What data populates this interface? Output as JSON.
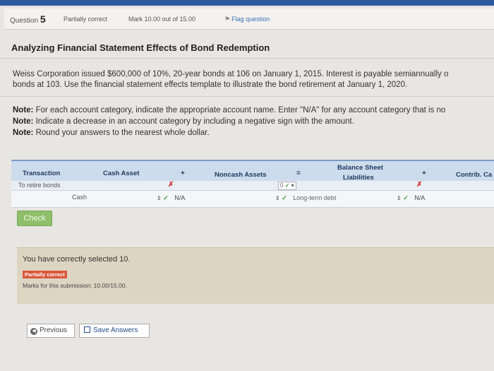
{
  "header": {
    "question_label": "Question",
    "question_number": "5",
    "status": "Partially correct",
    "mark": "Mark 10.00 out of 15.00",
    "flag": "Flag question"
  },
  "title": "Analyzing Financial Statement Effects of Bond Redemption",
  "problem": {
    "line1": "Weiss Corporation issued $600,000 of 10%, 20-year bonds at 106 on January 1, 2015. Interest is payable semiannually o",
    "line2": "bonds at 103. Use the financial statement effects template to illustrate the bond retirement at January 1, 2020."
  },
  "notes": [
    {
      "label": "Note:",
      "text": " For each account category, indicate the appropriate account name. Enter \"N/A\" for any account category that is no"
    },
    {
      "label": "Note:",
      "text": " Indicate a decrease in an account category by including a negative sign with the amount."
    },
    {
      "label": "Note:",
      "text": " Round your answers to the nearest whole dollar."
    }
  ],
  "table": {
    "balance_sheet_label": "Balance Sheet",
    "headers": {
      "transaction": "Transaction",
      "cash_asset": "Cash Asset",
      "plus1": "+",
      "noncash_assets": "Noncash Assets",
      "equals": "=",
      "liabilities": "Liabilities",
      "plus2": "+",
      "contrib": "Contrib. Ca"
    },
    "row_label": "To retire bonds",
    "row": {
      "cash_account": "Cash",
      "noncash_value": "N/A",
      "liability_dropdown": "0",
      "liability_account": "Long-term debt",
      "contrib_value": "N/A"
    }
  },
  "check_button": "Check",
  "feedback": {
    "message": "You have correctly selected 10.",
    "badge": "Partially correct",
    "marks": "Marks for this submission: 10.00/15.00."
  },
  "nav": {
    "previous": "Previous",
    "save": "Save Answers"
  },
  "colors": {
    "top_bar": "#2c5aa0",
    "check_button": "#8fbf6a",
    "badge": "#d9573a",
    "feedback_bg": "#ddd5c2"
  }
}
